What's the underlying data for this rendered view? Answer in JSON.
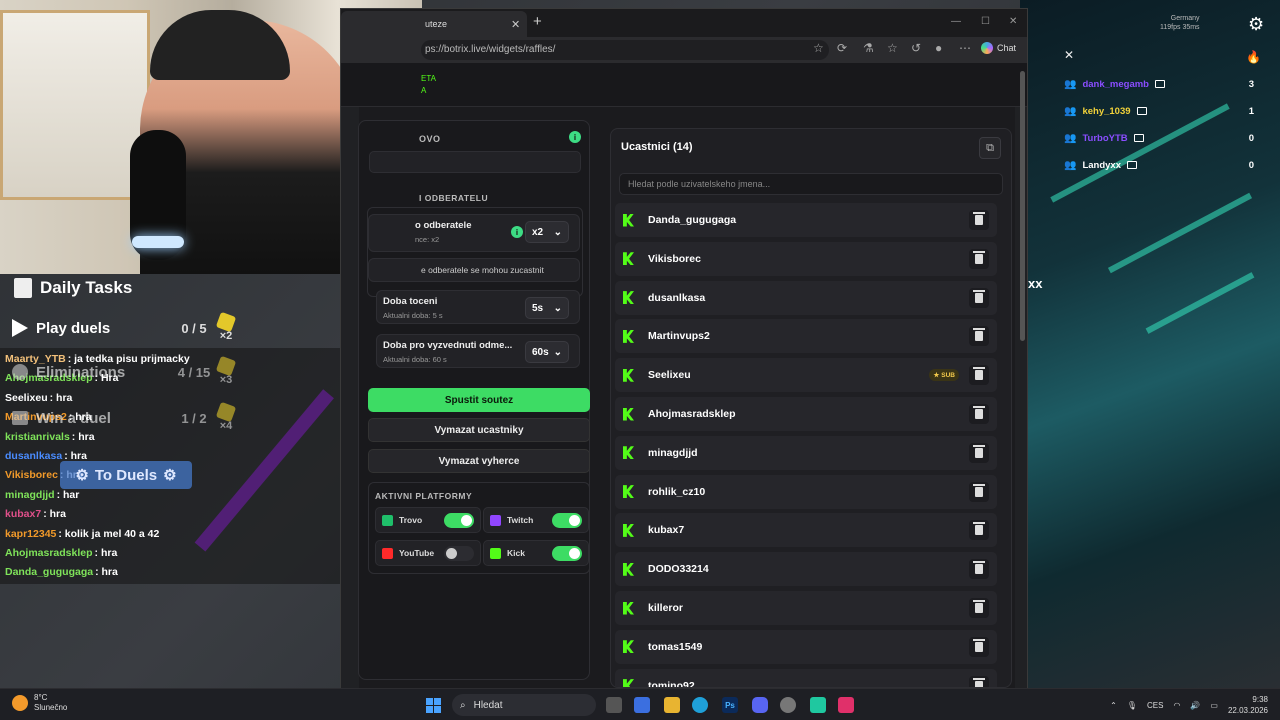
{
  "browser": {
    "tab_title": "uteze",
    "url": "ps://botrix.live/widgets/raffles/",
    "copilot_label": "Chat",
    "site_logo_line1": "ETA",
    "site_logo_line2": "A"
  },
  "settings": {
    "header_fragment": "OVO",
    "subscribers_section": "I ODBERATELU",
    "sub_label": "o odberatele",
    "sub_sub": "nce: x2",
    "sub_value": "x2",
    "sub_only_fragment": "e odberatele se mohou zucastnit",
    "spin_label": "Doba toceni",
    "spin_sub": "Aktualni doba: 5 s",
    "spin_value": "5s",
    "claim_label": "Doba pro vyzvednuti odme...",
    "claim_sub": "Aktualni doba: 60 s",
    "claim_value": "60s",
    "start_button": "Spustit soutez",
    "clear_participants_button": "Vymazat ucastniky",
    "clear_winners_button": "Vymazat vyherce",
    "platforms_title": "AKTIVNI PLATFORMY",
    "platforms": [
      {
        "name": "Trovo",
        "enabled": true,
        "color": "#1fbf6a"
      },
      {
        "name": "Twitch",
        "enabled": true,
        "color": "#9146ff"
      },
      {
        "name": "YouTube",
        "enabled": false,
        "color": "#ff2a2a"
      },
      {
        "name": "Kick",
        "enabled": true,
        "color": "#53fc18"
      }
    ]
  },
  "participants": {
    "title": "Ucastnici (14)",
    "search_placeholder": "Hledat podle uzivatelskeho jmena...",
    "sub_badge": "SUB",
    "list": [
      {
        "name": "Danda_gugugaga",
        "sub": false
      },
      {
        "name": "Vikisborec",
        "sub": false
      },
      {
        "name": "dusanlkasa",
        "sub": false
      },
      {
        "name": "Martinvups2",
        "sub": false
      },
      {
        "name": "Seelixeu",
        "sub": true
      },
      {
        "name": "Ahojmasradsklep",
        "sub": false
      },
      {
        "name": "minagdjjd",
        "sub": false
      },
      {
        "name": "rohlik_cz10",
        "sub": false
      },
      {
        "name": "kubax7",
        "sub": false
      },
      {
        "name": "DODO33214",
        "sub": false
      },
      {
        "name": "killeror",
        "sub": false
      },
      {
        "name": "tomas1549",
        "sub": false
      },
      {
        "name": "tomino92",
        "sub": false
      }
    ]
  },
  "daily_tasks": {
    "title": "Daily Tasks",
    "tasks": [
      {
        "label": "Play duels",
        "progress": "0 / 5",
        "mult": "×2"
      },
      {
        "label": "Eliminations",
        "progress": "4 / 15",
        "mult": "×3"
      },
      {
        "label": "Win a duel",
        "progress": "1 / 2",
        "mult": "×4"
      }
    ],
    "to_duels": "To Duels"
  },
  "chat": [
    {
      "user": "Maarty_YTB",
      "msg": ": ja tedka pisu prijmacky",
      "color": "#f2c07a"
    },
    {
      "user": "Ahojmasradsklep",
      "msg": ": Hra",
      "color": "#7fe35a"
    },
    {
      "user": "Seelixeu",
      "msg": ": hra",
      "color": "#ffffff"
    },
    {
      "user": "Martinvups2",
      "msg": ": hra",
      "color": "#f29a2a"
    },
    {
      "user": "kristianrivals",
      "msg": ": hra",
      "color": "#7fe35a"
    },
    {
      "user": "dusanlkasa",
      "msg": ": hra",
      "color": "#4a8cff"
    },
    {
      "user": "Vikisborec",
      "msg": ": hra",
      "color": "#f29a2a"
    },
    {
      "user": "minagdjjd",
      "msg": ": har",
      "color": "#7fe35a"
    },
    {
      "user": "kubax7",
      "msg": ": hra",
      "color": "#e0508a"
    },
    {
      "user": "kapr12345",
      "msg": ": kolik ja mel 40 a 42",
      "color": "#f29a2a"
    },
    {
      "user": "Ahojmasradsklep",
      "msg": ": hra",
      "color": "#7fe35a"
    },
    {
      "user": "Danda_gugugaga",
      "msg": ": hra",
      "color": "#7fe35a"
    }
  ],
  "overlay": {
    "stats_region": "Germany",
    "stats_perf": "119fps  35ms",
    "players": [
      {
        "name": "dank_megamb",
        "score": "3",
        "color": "#8a4dff"
      },
      {
        "name": "kehy_1039",
        "score": "1",
        "color": "#f2d23a"
      },
      {
        "name": "TurboYTB",
        "score": "0",
        "color": "#8a4dff"
      },
      {
        "name": "Landyxx",
        "score": "0",
        "color": "#ffffff"
      }
    ],
    "world_text": "xx"
  },
  "taskbar": {
    "temperature": "8°C",
    "weather": "Slunečno",
    "search": "Hledat",
    "language": "CES",
    "time": "9:38",
    "date": "22.03.2026"
  }
}
